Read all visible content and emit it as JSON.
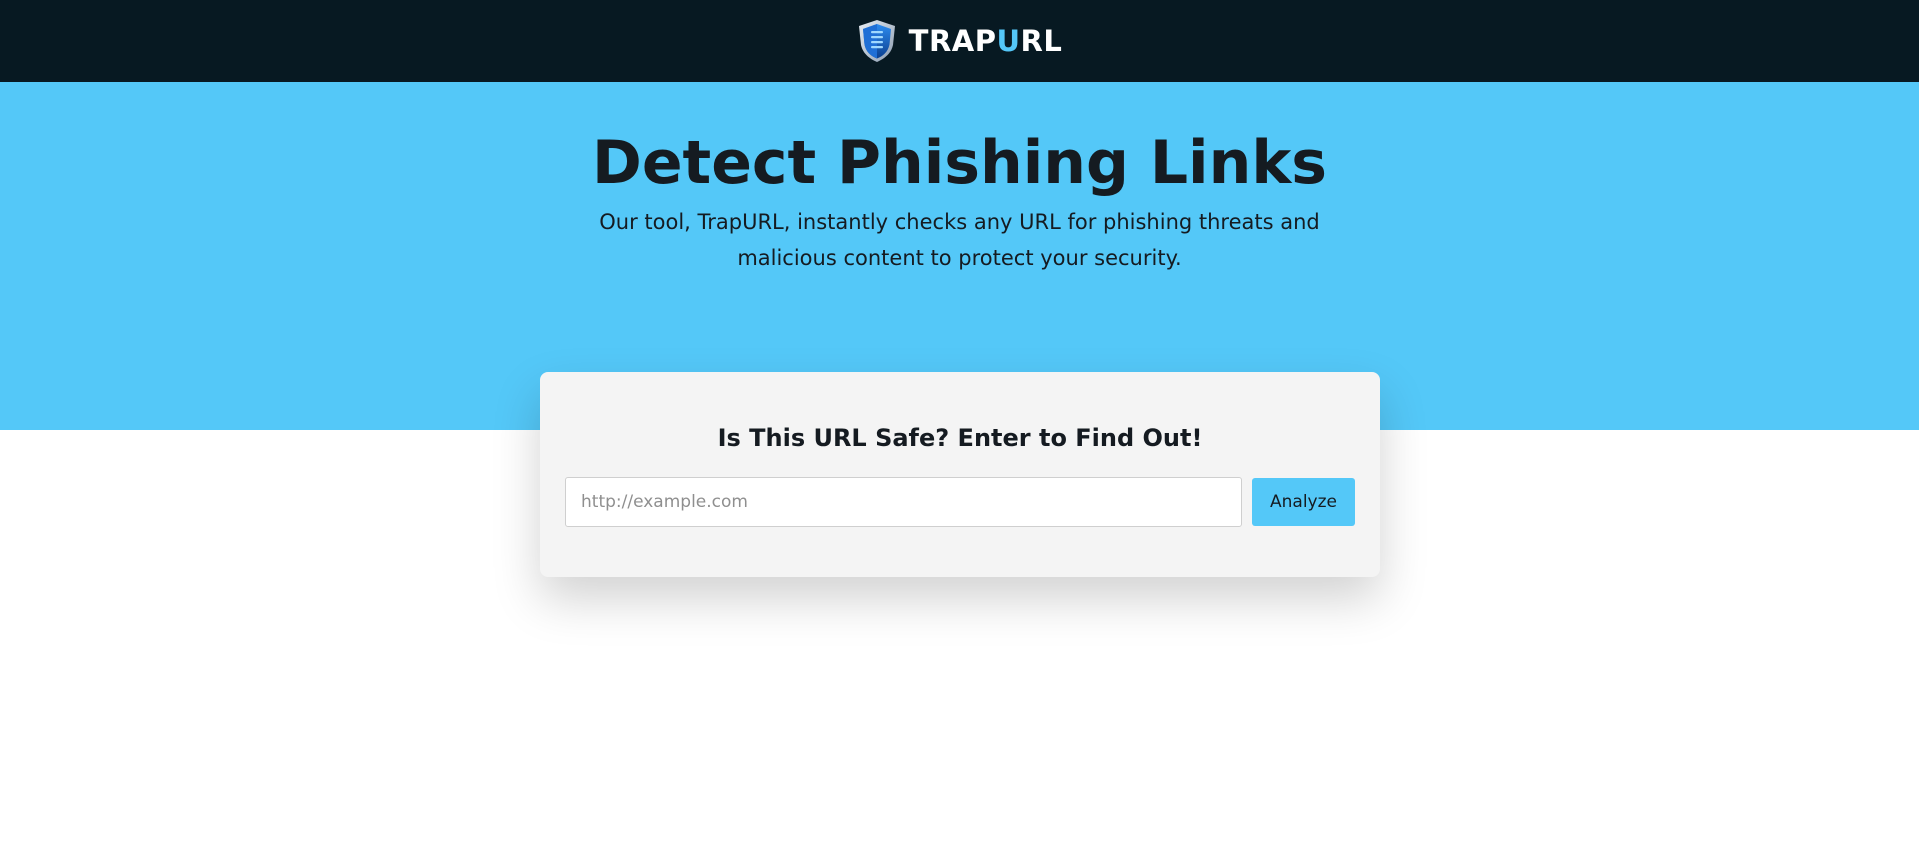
{
  "header": {
    "brand_prefix": "TRAP",
    "brand_accent": "U",
    "brand_suffix": "RL",
    "logo_icon": "shield-icon",
    "background_color": "#071922",
    "accent_color": "#54c7f8"
  },
  "hero": {
    "title": "Detect Phishing Links",
    "subtitle": "Our tool, TrapURL, instantly checks any URL for phishing threats and malicious content to protect your security.",
    "background_color": "#54c8f8"
  },
  "checker": {
    "heading": "Is This URL Safe? Enter to Find Out!",
    "input_placeholder": "http://example.com",
    "input_value": "",
    "button_label": "Analyze",
    "button_color": "#54c8f8"
  }
}
